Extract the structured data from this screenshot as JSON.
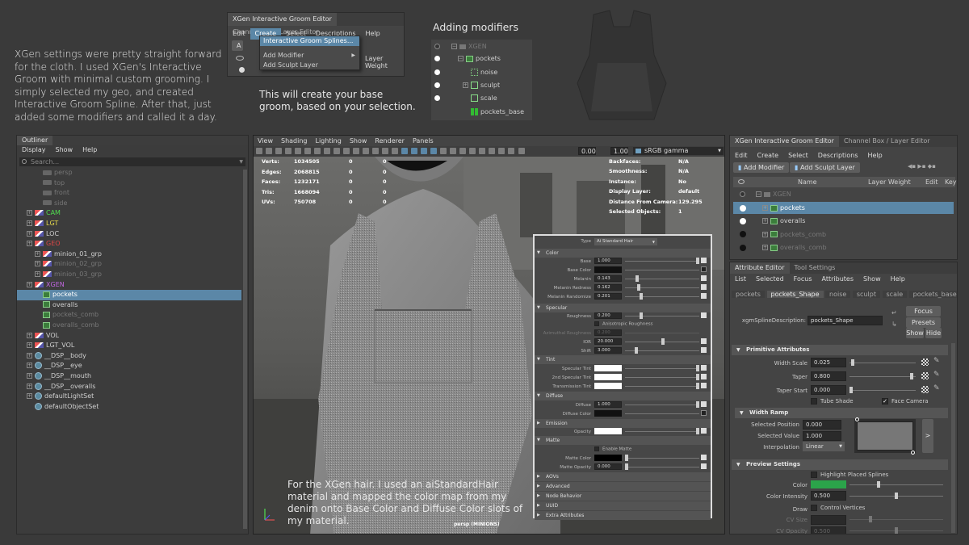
{
  "intro_text": "XGen settings were pretty straight forward for the cloth. I used XGen's Interactive Groom with minimal custom grooming. I simply selected my geo, and created Interactive Groom Spline. After that, just added some modifiers and called it a day.",
  "create_menu_note": "This will create your base groom, based on your selection.",
  "modifiers_heading": "Adding modifiers",
  "viewport_note": "For the XGen hair. I used an aiStandardHair material and mapped the color map from my denim onto Base Color and Diffuse Color slots of my material.",
  "mini_editor": {
    "tabs": [
      "XGen Interactive Groom Editor",
      "Channel Box / Layer Editor"
    ],
    "menu": [
      "Edit",
      "Create",
      "Select",
      "Descriptions",
      "Help"
    ],
    "dropdown": [
      "Interactive Groom Splines...",
      "Add Modifier",
      "Add Sculpt Layer"
    ],
    "col_layer_weight": "Layer Weight",
    "xgen_dim": "XGEN"
  },
  "modifiers_tree": {
    "root": "XGEN",
    "desc": "pockets",
    "items": [
      "noise",
      "sculpt",
      "scale",
      "pockets_base"
    ]
  },
  "outliner": {
    "title": "Outliner",
    "menu": [
      "Display",
      "Show",
      "Help"
    ],
    "search": "Search...",
    "items": [
      {
        "label": "persp",
        "kind": "cam",
        "indent": 1,
        "dim": true
      },
      {
        "label": "top",
        "kind": "cam",
        "indent": 1,
        "dim": true
      },
      {
        "label": "front",
        "kind": "cam",
        "indent": 1,
        "dim": true
      },
      {
        "label": "side",
        "kind": "cam",
        "indent": 1,
        "dim": true
      },
      {
        "label": "CAM",
        "kind": "grp",
        "indent": 0,
        "color": "#4fd84f"
      },
      {
        "label": "LGT",
        "kind": "grp",
        "indent": 0,
        "color": "#e6d84a"
      },
      {
        "label": "LOC",
        "kind": "grp",
        "indent": 0
      },
      {
        "label": "GEO",
        "kind": "grp",
        "indent": 0,
        "color": "#e04646"
      },
      {
        "label": "minion_01_grp",
        "kind": "grp",
        "indent": 1
      },
      {
        "label": "minion_02_grp",
        "kind": "grp",
        "indent": 1,
        "dim": true
      },
      {
        "label": "minion_03_grp",
        "kind": "grp",
        "indent": 1,
        "dim": true
      },
      {
        "label": "XGEN",
        "kind": "grp",
        "indent": 0,
        "color": "#c066e0"
      },
      {
        "label": "pockets",
        "kind": "xg",
        "indent": 1,
        "selected": true
      },
      {
        "label": "overalls",
        "kind": "xg",
        "indent": 1
      },
      {
        "label": "pockets_comb",
        "kind": "xg",
        "indent": 1,
        "dim": true
      },
      {
        "label": "overalls_comb",
        "kind": "xg",
        "indent": 1,
        "dim": true
      },
      {
        "label": "VOL",
        "kind": "grp",
        "indent": 0
      },
      {
        "label": "LGT_VOL",
        "kind": "grp",
        "indent": 0
      },
      {
        "label": "__DSP__body",
        "kind": "set",
        "indent": 0
      },
      {
        "label": "__DSP__eye",
        "kind": "set",
        "indent": 0
      },
      {
        "label": "__DSP__mouth",
        "kind": "set",
        "indent": 0
      },
      {
        "label": "__DSP__overalls",
        "kind": "set",
        "indent": 0
      },
      {
        "label": "defaultLightSet",
        "kind": "set",
        "indent": 0
      },
      {
        "label": "defaultObjectSet",
        "kind": "set",
        "indent": 0
      }
    ]
  },
  "viewport": {
    "menu": [
      "View",
      "Shading",
      "Lighting",
      "Show",
      "Renderer",
      "Panels"
    ],
    "field1": "0.00",
    "field2": "1.00",
    "colorspace": "sRGB gamma",
    "stats": [
      {
        "k": "Verts:",
        "v": "1034505",
        "a": "0",
        "b": "0"
      },
      {
        "k": "Edges:",
        "v": "2068815",
        "a": "0",
        "b": "0"
      },
      {
        "k": "Faces:",
        "v": "1232171",
        "a": "0",
        "b": "0"
      },
      {
        "k": "Tris:",
        "v": "1668094",
        "a": "0",
        "b": "0"
      },
      {
        "k": "UVs:",
        "v": "750708",
        "a": "0",
        "b": "0"
      }
    ],
    "info": [
      {
        "k": "Backfaces:",
        "v": "N/A"
      },
      {
        "k": "Smoothness:",
        "v": "N/A"
      },
      {
        "k": "Instance:",
        "v": "No"
      },
      {
        "k": "Display Layer:",
        "v": "default"
      },
      {
        "k": "Distance From Camera:",
        "v": "129.295"
      },
      {
        "k": "Selected Objects:",
        "v": "1"
      }
    ],
    "camera": "persp (MINIONS)"
  },
  "material": {
    "type_label": "Type",
    "type_value": "Ai Standard Hair",
    "color_hdr": "Color",
    "base": "Base",
    "base_v": "1.000",
    "base_color": "Base Color",
    "melanin": "Melanin",
    "melanin_v": "0.143",
    "melanin_red": "Melanin Redness",
    "melanin_red_v": "0.162",
    "melanin_rand": "Melanin Randomize",
    "melanin_rand_v": "0.201",
    "specular_hdr": "Specular",
    "rough": "Roughness",
    "rough_v": "0.200",
    "aniso": "Anisotropic Roughness",
    "azim": "Azimuthal Roughness",
    "azim_v": "0.200",
    "ior": "IOR",
    "ior_v": "20.000",
    "shift": "Shift",
    "shift_v": "3.000",
    "tint_hdr": "Tint",
    "spec_tint": "Specular Tint",
    "spec2_tint": "2nd Specular Tint",
    "trans_tint": "Transmission Tint",
    "diffuse_hdr": "Diffuse",
    "diffuse": "Diffuse",
    "diffuse_v": "1.000",
    "diffuse_color": "Diffuse Color",
    "emission_hdr": "Emission",
    "opacity": "Opacity",
    "matte_hdr": "Matte",
    "enable_matte": "Enable Matte",
    "matte_color": "Matte Color",
    "matte_opacity": "Matte Opacity",
    "matte_opacity_v": "0.000",
    "collapsed": [
      "AOVs",
      "Advanced",
      "Node Behavior",
      "UUID",
      "Extra Attributes"
    ]
  },
  "xgen_editor": {
    "tabs": [
      "XGen Interactive Groom Editor",
      "Channel Box / Layer Editor"
    ],
    "menu": [
      "Edit",
      "Create",
      "Select",
      "Descriptions",
      "Help"
    ],
    "add_modifier": "Add Modifier",
    "add_sculpt": "Add Sculpt Layer",
    "cols": [
      "Name",
      "Layer Weight",
      "Edit",
      "Key"
    ],
    "root": "XGEN",
    "rows": [
      {
        "label": "pockets",
        "selected": true
      },
      {
        "label": "overalls"
      },
      {
        "label": "pockets_comb",
        "dim": true
      },
      {
        "label": "overalls_comb",
        "dim": true
      }
    ]
  },
  "attr_editor": {
    "tabs": [
      "Attribute Editor",
      "Tool Settings"
    ],
    "menu": [
      "List",
      "Selected",
      "Focus",
      "Attributes",
      "Show",
      "Help"
    ],
    "node_tabs": [
      "pockets",
      "pockets_Shape",
      "noise",
      "sculpt",
      "scale",
      "pockets_base"
    ],
    "desc_label": "xgmSplineDescription:",
    "desc_value": "pockets_Shape",
    "focus": "Focus",
    "presets": "Presets",
    "show": "Show",
    "hide": "Hide",
    "primitive": "Primitive Attributes",
    "width_scale": "Width Scale",
    "width_scale_v": "0.025",
    "taper": "Taper",
    "taper_v": "0.800",
    "taper_start": "Taper Start",
    "taper_start_v": "0.000",
    "tube_shade": "Tube Shade",
    "face_camera": "Face Camera",
    "width_ramp": "Width Ramp",
    "sel_pos": "Selected Position",
    "sel_pos_v": "0.000",
    "sel_val": "Selected Value",
    "sel_val_v": "1.000",
    "interp": "Interpolation",
    "interp_v": "Linear",
    "preview": "Preview Settings",
    "highlight": "Highlight Placed Splines",
    "color": "Color",
    "color_int": "Color Intensity",
    "color_int_v": "0.500",
    "draw": "Draw",
    "ctrl_verts": "Control Vertices",
    "cv_size": "CV Size",
    "cv_opacity": "CV Opacity",
    "cv_opacity_v": "0.500",
    "ramp_arrow": ">"
  },
  "colors": {
    "selection": "#5b87a7",
    "face": "#2ba44a"
  }
}
